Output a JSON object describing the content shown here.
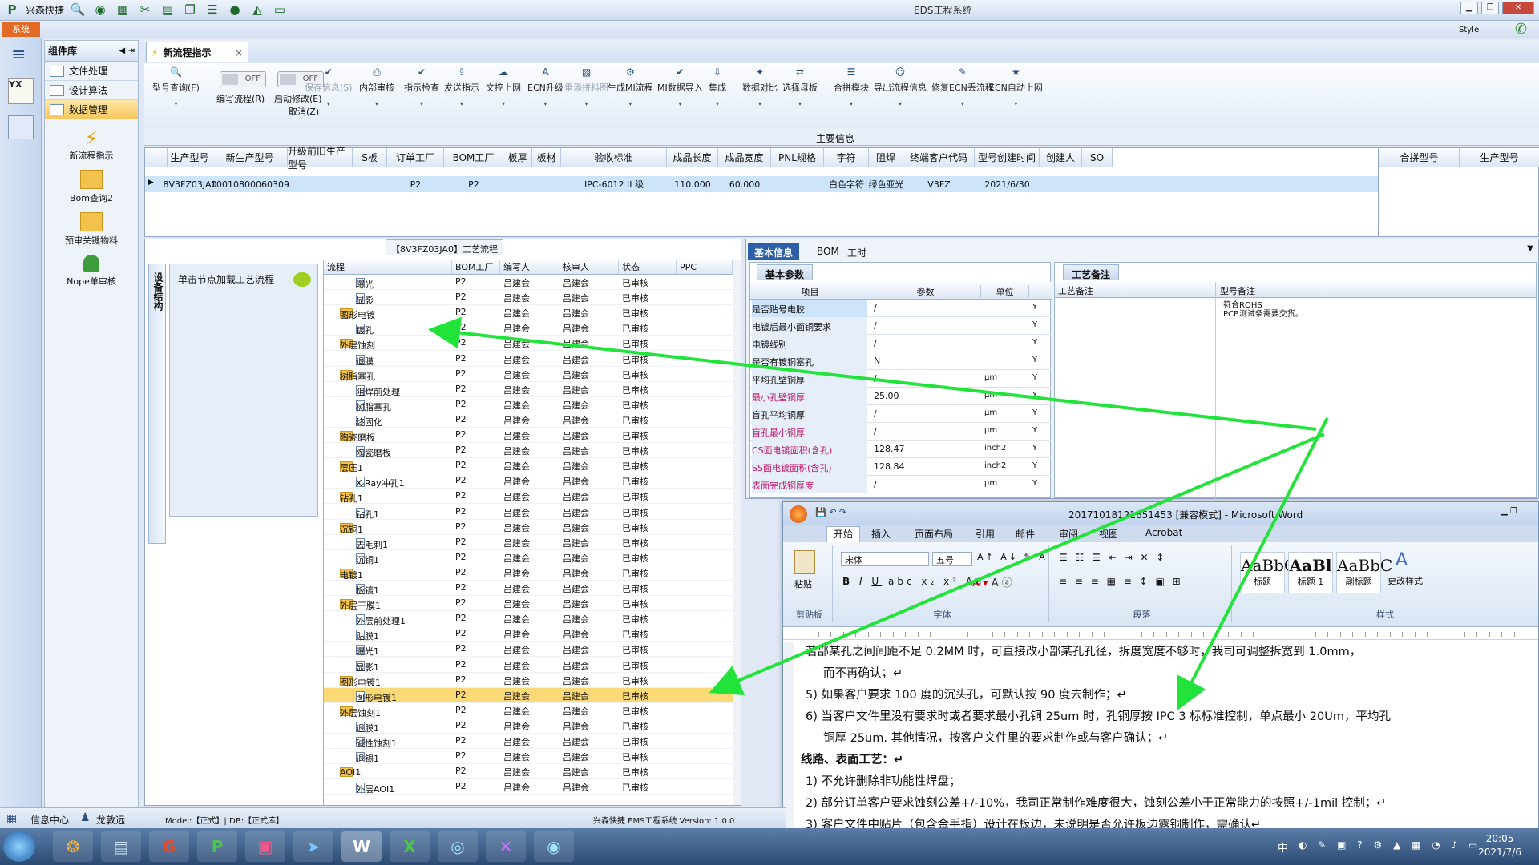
{
  "app": {
    "title": "EDS工程系统",
    "quick_label": "兴森快捷",
    "system_tab": "系统",
    "style_label": "Style"
  },
  "component_panel": {
    "title": "组件库",
    "items": [
      {
        "label": "文件处理"
      },
      {
        "label": "设计算法"
      },
      {
        "label": "数据管理"
      }
    ],
    "big_items": [
      {
        "label": "新流程指示"
      },
      {
        "label": "Bom查询2"
      },
      {
        "label": "预审关键物料"
      },
      {
        "label": "Nope单审核"
      }
    ]
  },
  "doc_tab": {
    "label": "新流程指示",
    "close": "×"
  },
  "ribbon": {
    "items": [
      {
        "label": "型号查询(F)",
        "icon": "search-icon"
      },
      {
        "label": "编写流程(R)",
        "icon": "toggle",
        "toggle": "OFF"
      },
      {
        "label": "启动修改(E)",
        "sub": "取消(Z)",
        "icon": "toggle",
        "toggle": "OFF"
      },
      {
        "label": "保存信息(S)",
        "icon": "check-icon",
        "disabled": true
      },
      {
        "label": "内部审核",
        "icon": "printer-icon"
      },
      {
        "label": "指示检查",
        "icon": "check-icon"
      },
      {
        "label": "发送指示",
        "icon": "upload-icon"
      },
      {
        "label": "文控上网",
        "icon": "cloud-icon"
      },
      {
        "label": "ECN升级",
        "icon": "letter-a-icon"
      },
      {
        "label": "重添拼料图",
        "icon": "image-icon",
        "disabled": true
      },
      {
        "label": "生成MI流程",
        "icon": "gears-icon"
      },
      {
        "label": "MI数据导入",
        "icon": "check-icon"
      },
      {
        "label": "集成",
        "icon": "download-icon"
      },
      {
        "label": "数据对比",
        "icon": "wand-icon"
      },
      {
        "label": "选择母板",
        "icon": "shuffle-icon"
      },
      {
        "label": "合拼模块",
        "icon": "list-icon"
      },
      {
        "label": "导出流程信息",
        "icon": "smiley-icon"
      },
      {
        "label": "修复ECN丢流程",
        "icon": "wrench-icon"
      },
      {
        "label": "ECN自动上网",
        "icon": "star-icon"
      }
    ]
  },
  "main_info": {
    "caption": "主要信息",
    "columns": [
      "生产型号",
      "新生产型号",
      "升级前旧生产型号",
      "S板",
      "订单工厂",
      "BOM工厂",
      "板厚",
      "板材",
      "验收标准",
      "成品长度",
      "成品宽度",
      "PNL规格",
      "字符",
      "阻焊",
      "终端客户代码",
      "型号创建时间",
      "创建人",
      "SO"
    ],
    "row": [
      "8V3FZ03JA0",
      "10010800060309",
      "",
      "",
      "P2",
      "P2",
      "",
      "",
      "IPC-6012 II 级",
      "110.000",
      "60.000",
      "",
      "白色字符",
      "绿色亚光",
      "V3FZ",
      "2021/6/30",
      "",
      ""
    ],
    "side_columns": [
      "合拼型号",
      "生产型号"
    ]
  },
  "process_tree": {
    "caption": "【8V3FZ03JA0】工艺流程",
    "side_tab": "设备结构",
    "hint": "单击节点加载工艺流程",
    "columns": [
      "流程",
      "BOM工厂",
      "编写人",
      "核审人",
      "状态",
      "PPC"
    ],
    "rows": [
      {
        "name": "曝光",
        "level": 2,
        "type": "doc",
        "factory": "P2",
        "writer": "吕建会",
        "reviewer": "吕建会",
        "status": "已审核"
      },
      {
        "name": "显影",
        "level": 2,
        "type": "doc",
        "factory": "P2",
        "writer": "吕建会",
        "reviewer": "吕建会",
        "status": "已审核"
      },
      {
        "name": "图形电镀",
        "level": 1,
        "type": "folder",
        "factory": "P2",
        "writer": "吕建会",
        "reviewer": "吕建会",
        "status": "已审核"
      },
      {
        "name": "镀孔",
        "level": 2,
        "type": "doc",
        "factory": "P2",
        "writer": "吕建会",
        "reviewer": "吕建会",
        "status": "已审核"
      },
      {
        "name": "外层蚀刻",
        "level": 1,
        "type": "folder",
        "factory": "P2",
        "writer": "吕建会",
        "reviewer": "吕建会",
        "status": "已审核"
      },
      {
        "name": "退膜",
        "level": 2,
        "type": "doc",
        "factory": "P2",
        "writer": "吕建会",
        "reviewer": "吕建会",
        "status": "已审核"
      },
      {
        "name": "树脂塞孔",
        "level": 1,
        "type": "folder",
        "factory": "P2",
        "writer": "吕建会",
        "reviewer": "吕建会",
        "status": "已审核"
      },
      {
        "name": "阻焊前处理",
        "level": 2,
        "type": "doc",
        "factory": "P2",
        "writer": "吕建会",
        "reviewer": "吕建会",
        "status": "已审核"
      },
      {
        "name": "树脂塞孔",
        "level": 2,
        "type": "doc",
        "factory": "P2",
        "writer": "吕建会",
        "reviewer": "吕建会",
        "status": "已审核"
      },
      {
        "name": "终固化",
        "level": 2,
        "type": "doc",
        "factory": "P2",
        "writer": "吕建会",
        "reviewer": "吕建会",
        "status": "已审核"
      },
      {
        "name": "陶瓷磨板",
        "level": 1,
        "type": "folder",
        "factory": "P2",
        "writer": "吕建会",
        "reviewer": "吕建会",
        "status": "已审核"
      },
      {
        "name": "陶瓷磨板",
        "level": 2,
        "type": "doc",
        "factory": "P2",
        "writer": "吕建会",
        "reviewer": "吕建会",
        "status": "已审核"
      },
      {
        "name": "层压1",
        "level": 1,
        "type": "folder",
        "factory": "P2",
        "writer": "吕建会",
        "reviewer": "吕建会",
        "status": "已审核"
      },
      {
        "name": "X-Ray冲孔1",
        "level": 2,
        "type": "doc",
        "factory": "P2",
        "writer": "吕建会",
        "reviewer": "吕建会",
        "status": "已审核"
      },
      {
        "name": "钻孔1",
        "level": 1,
        "type": "folder",
        "factory": "P2",
        "writer": "吕建会",
        "reviewer": "吕建会",
        "status": "已审核"
      },
      {
        "name": "钻孔1",
        "level": 2,
        "type": "doc",
        "factory": "P2",
        "writer": "吕建会",
        "reviewer": "吕建会",
        "status": "已审核"
      },
      {
        "name": "沉铜1",
        "level": 1,
        "type": "folder",
        "factory": "P2",
        "writer": "吕建会",
        "reviewer": "吕建会",
        "status": "已审核"
      },
      {
        "name": "去毛刺1",
        "level": 2,
        "type": "doc",
        "factory": "P2",
        "writer": "吕建会",
        "reviewer": "吕建会",
        "status": "已审核"
      },
      {
        "name": "沉铜1",
        "level": 2,
        "type": "doc",
        "factory": "P2",
        "writer": "吕建会",
        "reviewer": "吕建会",
        "status": "已审核"
      },
      {
        "name": "电镀1",
        "level": 1,
        "type": "folder",
        "factory": "P2",
        "writer": "吕建会",
        "reviewer": "吕建会",
        "status": "已审核"
      },
      {
        "name": "板镀1",
        "level": 2,
        "type": "doc",
        "factory": "P2",
        "writer": "吕建会",
        "reviewer": "吕建会",
        "status": "已审核"
      },
      {
        "name": "外层干膜1",
        "level": 1,
        "type": "folder",
        "factory": "P2",
        "writer": "吕建会",
        "reviewer": "吕建会",
        "status": "已审核"
      },
      {
        "name": "外层前处理1",
        "level": 2,
        "type": "doc",
        "factory": "P2",
        "writer": "吕建会",
        "reviewer": "吕建会",
        "status": "已审核"
      },
      {
        "name": "贴膜1",
        "level": 2,
        "type": "doc",
        "factory": "P2",
        "writer": "吕建会",
        "reviewer": "吕建会",
        "status": "已审核"
      },
      {
        "name": "曝光1",
        "level": 2,
        "type": "doc",
        "factory": "P2",
        "writer": "吕建会",
        "reviewer": "吕建会",
        "status": "已审核"
      },
      {
        "name": "显影1",
        "level": 2,
        "type": "doc",
        "factory": "P2",
        "writer": "吕建会",
        "reviewer": "吕建会",
        "status": "已审核"
      },
      {
        "name": "图形电镀1",
        "level": 1,
        "type": "folder",
        "factory": "P2",
        "writer": "吕建会",
        "reviewer": "吕建会",
        "status": "已审核"
      },
      {
        "name": "图形电镀1",
        "level": 2,
        "type": "doc",
        "factory": "P2",
        "writer": "吕建会",
        "reviewer": "吕建会",
        "status": "已审核",
        "highlight": true
      },
      {
        "name": "外层蚀刻1",
        "level": 1,
        "type": "folder",
        "factory": "P2",
        "writer": "吕建会",
        "reviewer": "吕建会",
        "status": "已审核"
      },
      {
        "name": "退膜1",
        "level": 2,
        "type": "doc",
        "factory": "P2",
        "writer": "吕建会",
        "reviewer": "吕建会",
        "status": "已审核"
      },
      {
        "name": "碱性蚀刻1",
        "level": 2,
        "type": "doc",
        "factory": "P2",
        "writer": "吕建会",
        "reviewer": "吕建会",
        "status": "已审核"
      },
      {
        "name": "退锡1",
        "level": 2,
        "type": "doc",
        "factory": "P2",
        "writer": "吕建会",
        "reviewer": "吕建会",
        "status": "已审核"
      },
      {
        "name": "AOI1",
        "level": 1,
        "type": "folder",
        "factory": "P2",
        "writer": "吕建会",
        "reviewer": "吕建会",
        "status": "已审核"
      },
      {
        "name": "外层AOI1",
        "level": 2,
        "type": "doc",
        "factory": "P2",
        "writer": "吕建会",
        "reviewer": "吕建会",
        "status": "已审核"
      }
    ]
  },
  "right_panel": {
    "tabs": [
      "基本信息",
      "BOM",
      "工时"
    ],
    "basic_title": "基本参数",
    "basic_columns": [
      "项目",
      "参数",
      "单位"
    ],
    "params": [
      {
        "item": "是否贴号电胶",
        "value": "/",
        "unit": "",
        "flag": "Y",
        "red": false
      },
      {
        "item": "电镀后最小面铜要求",
        "value": "/",
        "unit": "",
        "flag": "Y",
        "red": false
      },
      {
        "item": "电镀线别",
        "value": "/",
        "unit": "",
        "flag": "Y",
        "red": false
      },
      {
        "item": "是否有镀铜塞孔",
        "value": "N",
        "unit": "",
        "flag": "Y",
        "red": false
      },
      {
        "item": "平均孔壁铜厚",
        "value": "/",
        "unit": "μm",
        "flag": "Y",
        "red": false
      },
      {
        "item": "最小孔壁铜厚",
        "value": "25.00",
        "unit": "μm",
        "flag": "Y",
        "red": true
      },
      {
        "item": "盲孔平均铜厚",
        "value": "/",
        "unit": "μm",
        "flag": "Y",
        "red": false
      },
      {
        "item": "盲孔最小铜厚",
        "value": "/",
        "unit": "μm",
        "flag": "Y",
        "red": true
      },
      {
        "item": "CS面电镀面积(含孔)",
        "value": "128.47",
        "unit": "inch2",
        "flag": "Y",
        "red": true
      },
      {
        "item": "SS面电镀面积(含孔)",
        "value": "128.84",
        "unit": "inch2",
        "flag": "Y",
        "red": true
      },
      {
        "item": "表面完成铜厚度",
        "value": "/",
        "unit": "μm",
        "flag": "Y",
        "red": true
      }
    ],
    "craft_title": "工艺备注",
    "craft_columns": [
      "工艺备注",
      "型号备注"
    ],
    "model_note_lines": [
      "符合ROHS",
      "PCB测试条需要交货。"
    ]
  },
  "word": {
    "title": "20171018121651453 [兼容模式] - Microsoft Word",
    "tabs": [
      "开始",
      "插入",
      "页面布局",
      "引用",
      "邮件",
      "审阅",
      "视图",
      "Acrobat"
    ],
    "font": "宋体",
    "size": "五号",
    "groups": [
      "剪贴板",
      "字体",
      "段落",
      "样式"
    ],
    "paste": "粘贴",
    "styles": [
      {
        "sample": "AaBbC",
        "name": "标题"
      },
      {
        "sample": "AaBl",
        "name": "标题 1"
      },
      {
        "sample": "AaBbC",
        "name": "副标题"
      }
    ],
    "change_styles": "更改样式",
    "lines": [
      "若部某孔之间间距不足 0.2MM 时，可直接改小部某孔孔径，拆度宽度不够时，我司可调整拆宽到 1.0mm，",
      "而不再确认；↵",
      "5) 如果客户要求 100 度的沉头孔，可默认按 90 度去制作；↵",
      "6) 当客户文件里没有要求时或者要求最小孔铜 25um 时，孔铜厚按 IPC 3 标标准控制，单点最小 20Um，平均孔",
      "铜厚 25um. 其他情况，按客户文件里的要求制作或与客户确认；↵",
      "线路、表面工艺：↵",
      "1) 不允许删除非功能性焊盘；",
      "2) 部分订单客户要求蚀刻公差+/-10%，我司正常制作难度很大，蚀刻公差小于正常能力的按照+/-1mil 控制；↵",
      "3) 客户文件中贴片（包含金手指）设计在板边，未说明是否允许板边露铜制作，需确认↵"
    ]
  },
  "status": {
    "left1": "信息中心",
    "left2": "龙敦远",
    "model": "Model:【正式】||DB:【正式库】",
    "right": "兴森快捷 EMS工程系统 Version: 1.0.0."
  },
  "taskbar": {
    "time": "20:05",
    "date": "2021/7/6",
    "ime": "中"
  },
  "colors": {
    "accent": "#2d5fa6",
    "highlight_row": "#fcd977",
    "arrow": "#22e33a"
  }
}
